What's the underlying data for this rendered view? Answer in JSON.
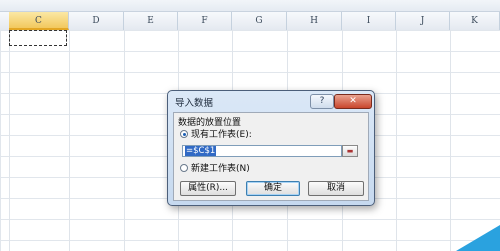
{
  "columns": [
    "C",
    "D",
    "E",
    "F",
    "G",
    "H",
    "I",
    "J",
    "K"
  ],
  "selected_column": "C",
  "dialog": {
    "title": "导入数据",
    "help_glyph": "?",
    "close_glyph": "✕",
    "group_label": "数据的放置位置",
    "option_existing": "现有工作表(E):",
    "option_new": "新建工作表(N)",
    "selected_option": "existing",
    "reference_value": "=$C$1",
    "properties_button": "属性(R)...",
    "ok_button": "确定",
    "cancel_button": "取消"
  },
  "colors": {
    "accent_corner": "#2aa2df",
    "selected_header": "#f2c85e",
    "close_button": "#c9462d"
  }
}
